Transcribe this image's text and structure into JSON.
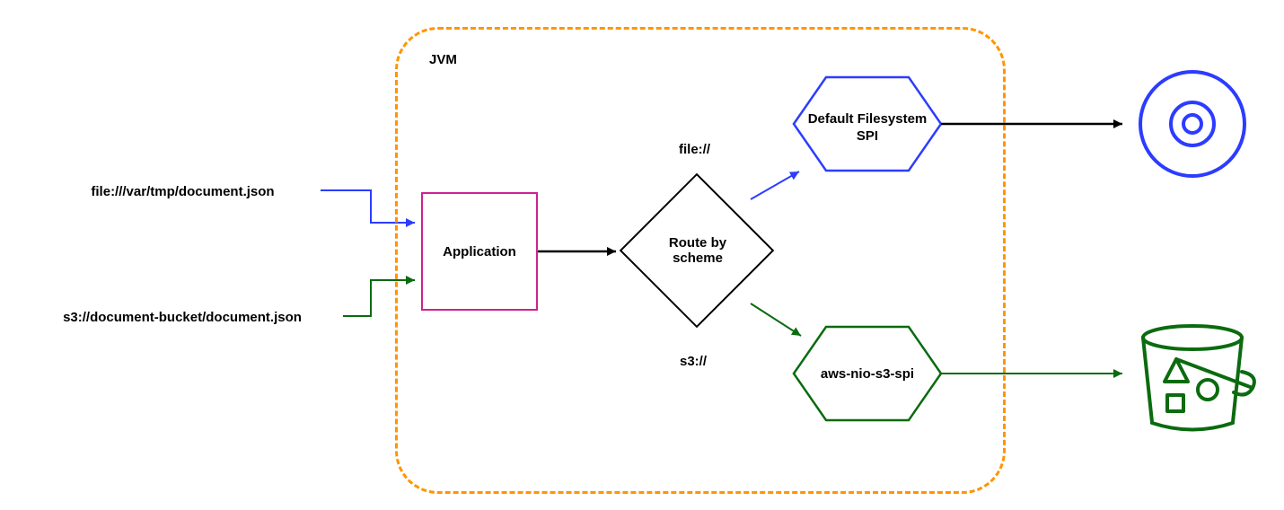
{
  "jvm": {
    "label": "JVM"
  },
  "application": {
    "label": "Application"
  },
  "router": {
    "label": "Route by scheme"
  },
  "schemes": {
    "file": "file://",
    "s3": "s3://"
  },
  "filesystems": {
    "default": "Default Filesystem SPI",
    "s3": "aws-nio-s3-spi"
  },
  "uris": {
    "local": "file:///var/tmp/document.json",
    "s3": "s3://document-bucket/document.json"
  },
  "storage": {
    "local": "",
    "s3": ""
  },
  "colors": {
    "orange": "#FF9500",
    "pink": "#CB2390",
    "blue": "#2C3CFF",
    "green": "#0B6B0F",
    "black": "#000000"
  }
}
